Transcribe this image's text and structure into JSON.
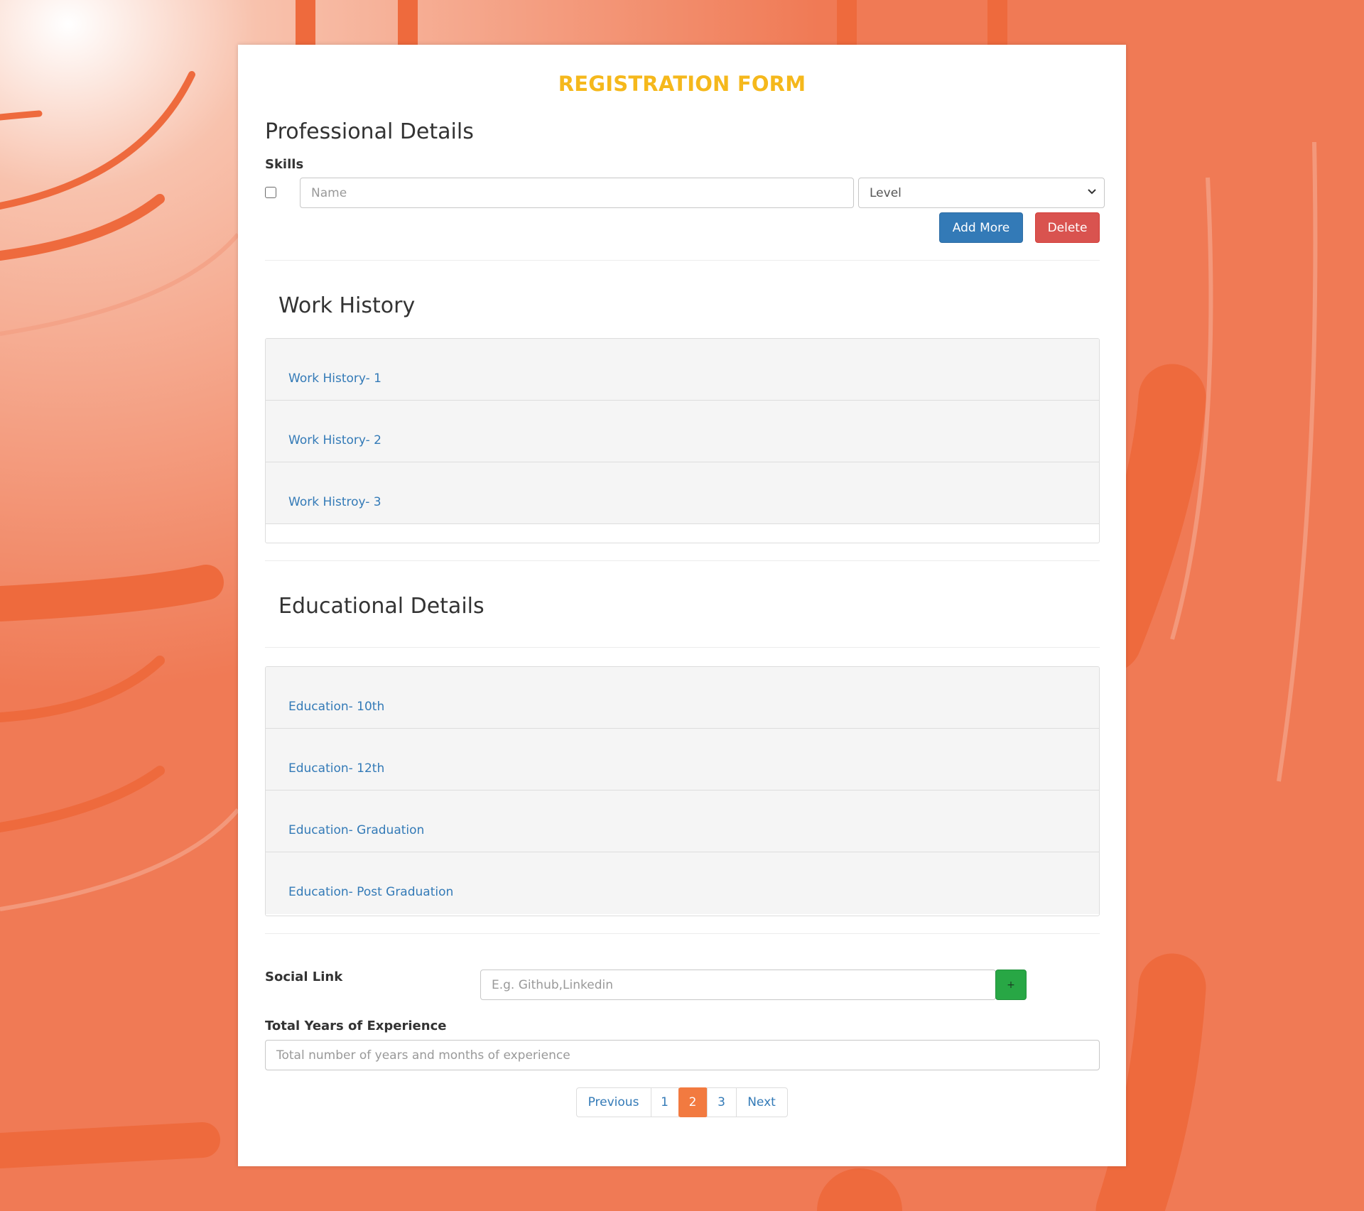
{
  "form": {
    "title": "REGISTRATION FORM"
  },
  "professional": {
    "heading": "Professional Details",
    "skills_label": "Skills",
    "name_placeholder": "Name",
    "level_selected": "Level",
    "add_more_label": "Add More",
    "delete_label": "Delete"
  },
  "work_history": {
    "heading": "Work History",
    "items": [
      "Work History- 1",
      "Work History- 2",
      "Work Histroy- 3"
    ]
  },
  "education": {
    "heading": "Educational Details",
    "items": [
      "Education- 10th",
      "Education- 12th",
      "Education- Graduation",
      "Education- Post Graduation"
    ]
  },
  "social": {
    "label": "Social Link",
    "placeholder": "E.g. Github,Linkedin",
    "add_label": "+"
  },
  "experience": {
    "label": "Total Years of Experience",
    "placeholder": "Total number of years and months of experience"
  },
  "pagination": {
    "previous": "Previous",
    "pages": [
      "1",
      "2",
      "3"
    ],
    "active_page": "2",
    "next": "Next"
  },
  "colors": {
    "title": "#f5b81c",
    "background": "#f27a55",
    "primary": "#337ab7",
    "danger": "#d9534f",
    "success": "#28a745",
    "active_page": "#f27a40"
  },
  "icons": {
    "select_arrow": "chevron-down-icon"
  }
}
